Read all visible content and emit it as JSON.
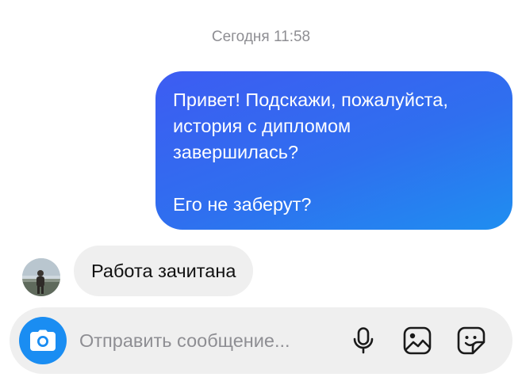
{
  "thread": {
    "timestamp": "Сегодня 11:58",
    "messages": [
      {
        "direction": "outgoing",
        "text": "Привет! Подскажи, пожалуйста,\nистория с дипломом\nзавершилась?\n\nЕго не заберут?"
      },
      {
        "direction": "incoming",
        "text": "Работа зачитана",
        "avatar_icon": "contact-avatar-photo"
      }
    ]
  },
  "composer": {
    "placeholder": "Отправить сообщение...",
    "value": "",
    "icons": {
      "camera": "camera-icon",
      "mic": "microphone-icon",
      "gallery": "image-icon",
      "sticker": "sticker-icon"
    }
  },
  "colors": {
    "outgoing_bubble_start": "#3d5cf2",
    "outgoing_bubble_end": "#1f8ef0",
    "incoming_bubble": "#efefef",
    "camera_button": "#1a8df2",
    "timestamp_text": "#8e8e93"
  }
}
